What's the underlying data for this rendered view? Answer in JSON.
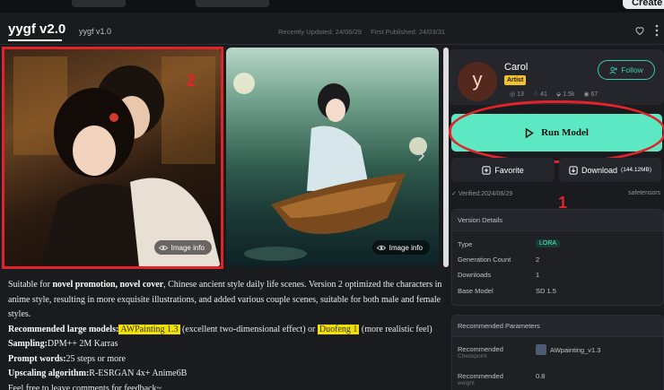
{
  "top": {
    "create_label": "Create"
  },
  "header": {
    "active_tab": "yygf v2.0",
    "other_tab": "yygf v1.0",
    "recently_updated": "Recently Updated: 24/06/29",
    "first_published": "First Published: 24/03/31"
  },
  "gallery": {
    "image_info_label": "Image info",
    "annotation_2": "2"
  },
  "description": {
    "p1_pre": "Suitable for ",
    "p1_bold": "novel promotion, novel cover",
    "p1_post": ", Chinese ancient style daily life scenes. Version 2 optimized the characters in anime style, resulting in more exquisite illustrations, and added various couple scenes, suitable for both male and female styles.",
    "rec_label": "Recommended large models:",
    "rec_model1": "AWPainting 1.3",
    "rec_mid": " (excellent two-dimensional effect) or ",
    "rec_model2": "Duofeng 1",
    "rec_post": " (more realistic feel)",
    "sampling_label": "Sampling:",
    "sampling_value": "DPM++ 2M Karras",
    "prompt_label": "Prompt words:",
    "prompt_value": "25 steps or more",
    "upscale_label": "Upscaling algorithm:",
    "upscale_value": "R-ESRGAN 4x+ Anime6B",
    "feedback": "Feel free to leave comments for feedback~"
  },
  "artist": {
    "avatar_letter": "y",
    "name": "Carol",
    "badge": "Artist",
    "stat1": "13",
    "stat2": "41",
    "stat3": "1.5k",
    "stat4": "67",
    "follow_label": "Follow"
  },
  "actions": {
    "run_label": "Run Model",
    "favorite_label": "Favorite",
    "download_label": "Download",
    "download_size": "(144.12MB)",
    "verified": "Verified:2024/06/29",
    "format": "safetensors",
    "annotation_1": "1"
  },
  "version_details": {
    "title": "Version Details",
    "type_label": "Type",
    "type_value": "LORA",
    "gen_label": "Generation Count",
    "gen_value": "2",
    "dl_label": "Downloads",
    "dl_value": "1",
    "base_label": "Base Model",
    "base_value": "SD 1.5"
  },
  "recommended_params": {
    "title": "Recommended Parameters",
    "ckpt_label": "Recommended",
    "ckpt_sub": "Checkpoint",
    "ckpt_value": "AWpainting_v1.3",
    "weight_label": "Recommended",
    "weight_sub": "weight",
    "weight_value": "0.8"
  },
  "colors": {
    "accent": "#5de8c4",
    "annotation_red": "#e0242a",
    "highlight": "#f2e100"
  }
}
